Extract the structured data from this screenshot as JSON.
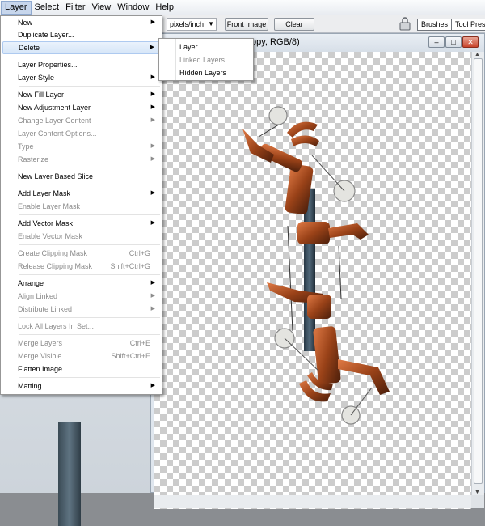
{
  "menubar": {
    "items": [
      "Layer",
      "Select",
      "Filter",
      "View",
      "Window",
      "Help"
    ]
  },
  "options": {
    "resolution_unit": "pixels/inch",
    "front_image": "Front Image",
    "clear": "Clear",
    "tab_brushes": "Brushes",
    "tab_tool_presets": "Tool Presets"
  },
  "document": {
    "title_partial": "opy, RGB/8)"
  },
  "layer_menu": {
    "items": [
      {
        "label": "New",
        "submenu": true,
        "disabled": false
      },
      {
        "label": "Duplicate Layer...",
        "submenu": false,
        "disabled": false
      },
      {
        "label": "Delete",
        "submenu": true,
        "disabled": false,
        "highlighted": true
      },
      {
        "label": "Layer Properties...",
        "submenu": false,
        "disabled": false
      },
      {
        "label": "Layer Style",
        "submenu": true,
        "disabled": false
      },
      {
        "label": "New Fill Layer",
        "submenu": true,
        "disabled": false
      },
      {
        "label": "New Adjustment Layer",
        "submenu": true,
        "disabled": false
      },
      {
        "label": "Change Layer Content",
        "submenu": true,
        "disabled": true
      },
      {
        "label": "Layer Content Options...",
        "submenu": false,
        "disabled": true
      },
      {
        "label": "Type",
        "submenu": true,
        "disabled": true
      },
      {
        "label": "Rasterize",
        "submenu": true,
        "disabled": true
      },
      {
        "label": "New Layer Based Slice",
        "submenu": false,
        "disabled": false
      },
      {
        "label": "Add Layer Mask",
        "submenu": true,
        "disabled": false
      },
      {
        "label": "Enable Layer Mask",
        "submenu": false,
        "disabled": true
      },
      {
        "label": "Add Vector Mask",
        "submenu": true,
        "disabled": false
      },
      {
        "label": "Enable Vector Mask",
        "submenu": false,
        "disabled": true
      },
      {
        "label": "Create Clipping Mask",
        "shortcut": "Ctrl+G",
        "disabled": true
      },
      {
        "label": "Release Clipping Mask",
        "shortcut": "Shift+Ctrl+G",
        "disabled": true
      },
      {
        "label": "Arrange",
        "submenu": true,
        "disabled": false
      },
      {
        "label": "Align Linked",
        "submenu": true,
        "disabled": true
      },
      {
        "label": "Distribute Linked",
        "submenu": true,
        "disabled": true
      },
      {
        "label": "Lock All Layers In Set...",
        "submenu": false,
        "disabled": true
      },
      {
        "label": "Merge Layers",
        "shortcut": "Ctrl+E",
        "disabled": true
      },
      {
        "label": "Merge Visible",
        "shortcut": "Shift+Ctrl+E",
        "disabled": true
      },
      {
        "label": "Flatten Image",
        "submenu": false,
        "disabled": false
      },
      {
        "label": "Matting",
        "submenu": true,
        "disabled": false
      }
    ]
  },
  "delete_submenu": {
    "items": [
      {
        "label": "Layer",
        "disabled": false
      },
      {
        "label": "Linked Layers",
        "disabled": true
      },
      {
        "label": "Hidden Layers",
        "disabled": false
      }
    ]
  }
}
